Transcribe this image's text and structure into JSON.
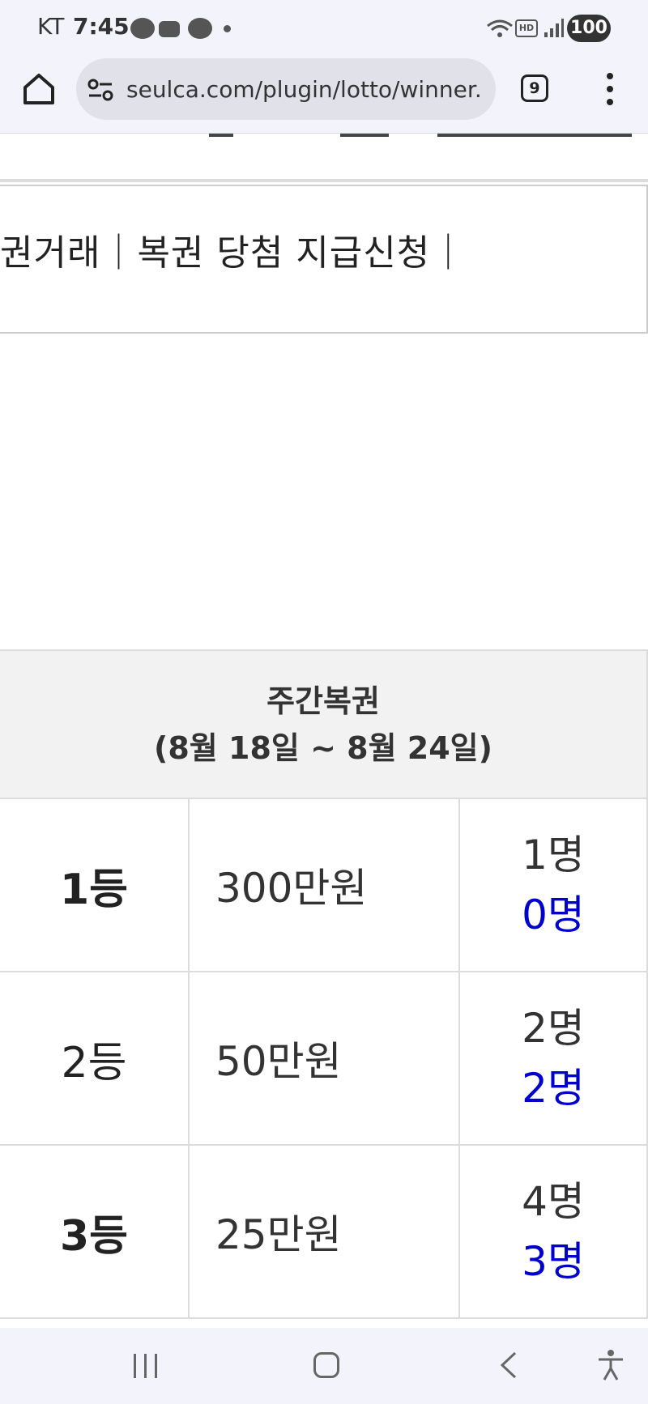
{
  "status_bar": {
    "carrier": "KT",
    "time": "7:45",
    "hd_label": "HD",
    "battery": "100",
    "icons": [
      "kakaotalk-icon",
      "voicemail-icon",
      "message-icon",
      "more-notifications-dot",
      "wifi-icon",
      "hd-voice-icon",
      "signal-icon",
      "battery-icon"
    ]
  },
  "browser": {
    "url": "seulca.com/plugin/lotto/winner.php",
    "tab_count": "9",
    "icons": [
      "home-icon",
      "site-info-icon",
      "tabs-icon",
      "more-menu-icon"
    ]
  },
  "page": {
    "menu_links": "권거래｜복권 당첨 지급신청｜",
    "table": {
      "header_title": "주간복권",
      "header_period": "(8월 18일 ~ 8월 24일)",
      "rows": [
        {
          "rank": "1등",
          "amount": "300만원",
          "total": "1명",
          "remaining": "0명"
        },
        {
          "rank": "2등",
          "amount": "50만원",
          "total": "2명",
          "remaining": "2명"
        },
        {
          "rank": "3등",
          "amount": "25만원",
          "total": "4명",
          "remaining": "3명"
        }
      ]
    }
  },
  "nav_bar": {
    "icons": [
      "recent-apps-icon",
      "home-nav-icon",
      "back-icon",
      "accessibility-icon"
    ]
  },
  "colors": {
    "remaining_count": "#0000cc",
    "header_bg": "#f2f2f2",
    "chrome_bg": "#f3f3fb"
  }
}
